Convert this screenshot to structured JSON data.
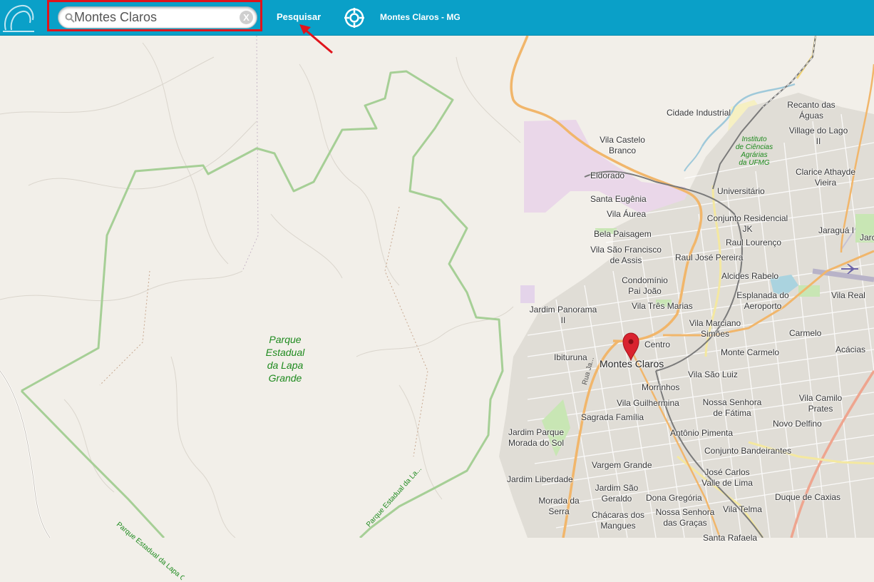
{
  "search": {
    "value": "Montes Claros",
    "clear_label": "X"
  },
  "toolbar": {
    "search_label": "Pesquisar",
    "location_label": "Montes Claros - MG"
  },
  "icons": {
    "logo": "logo-icon",
    "search": "search-icon",
    "clear": "close-icon",
    "locate": "crosshair-icon",
    "marker": "map-pin-icon",
    "airport": "airplane-icon"
  },
  "colors": {
    "topbar": "#0aa0c8",
    "highlight": "#e0141c",
    "park_border": "#a6cf96",
    "marker": "#d9232f"
  },
  "map": {
    "park_name": "Parque Estadual da Lapa Grande",
    "park_name_lines": [
      "Parque",
      "Estadual",
      "da Lapa",
      "Grande"
    ],
    "park_boundary_label_1": "Parque Estadual da Lapa Grande",
    "park_boundary_label_2": "Parque Estadual da La...",
    "city": "Montes Claros",
    "road_label": "Rua Ja...",
    "institute": [
      "Instituto",
      "de Ciências",
      "Agrárias",
      "da UFMG"
    ],
    "neighborhoods": [
      "Cidade Industrial",
      "Recanto das Águas",
      "Village do Lago II",
      "Vila Castelo Branco",
      "Eldorado",
      "Clarice Athayde Vieira",
      "Santa Eugênia",
      "Universitário",
      "Vila Áurea",
      "Conjunto Residencial JK",
      "Jaraguá I",
      "Bela Paisagem",
      "Raul Lourenço",
      "Vila São Francisco de Assis",
      "Raul José Pereira",
      "Condomínio Pai João",
      "Alcides Rabelo",
      "Vila Real",
      "Esplanada do Aeroporto",
      "Jardim Panorama II",
      "Vila Três Marias",
      "Vila Marciano Simões",
      "Carmelo",
      "Centro",
      "Ibituruna",
      "Monte Carmelo",
      "Acácias",
      "Vila São Luiz",
      "Morrinhos",
      "Vila Camilo Prates",
      "Vila Guilhermina",
      "Nossa Senhora de Fátima",
      "Sagrada Família",
      "Novo Delfino",
      "Jardim Parque Morada do Sol",
      "Antônio Pimenta",
      "Conjunto Bandeirantes",
      "Vargem Grande",
      "José Carlos Valle de Lima",
      "Jardim Liberdade",
      "Jardim São Geraldo",
      "Dona Gregória",
      "Duque de Caxias",
      "Morada da Serra",
      "Chácaras dos Mangues",
      "Nossa Senhora das Graças",
      "Vila Telma",
      "Santa Rafaela",
      "Jarc"
    ]
  }
}
